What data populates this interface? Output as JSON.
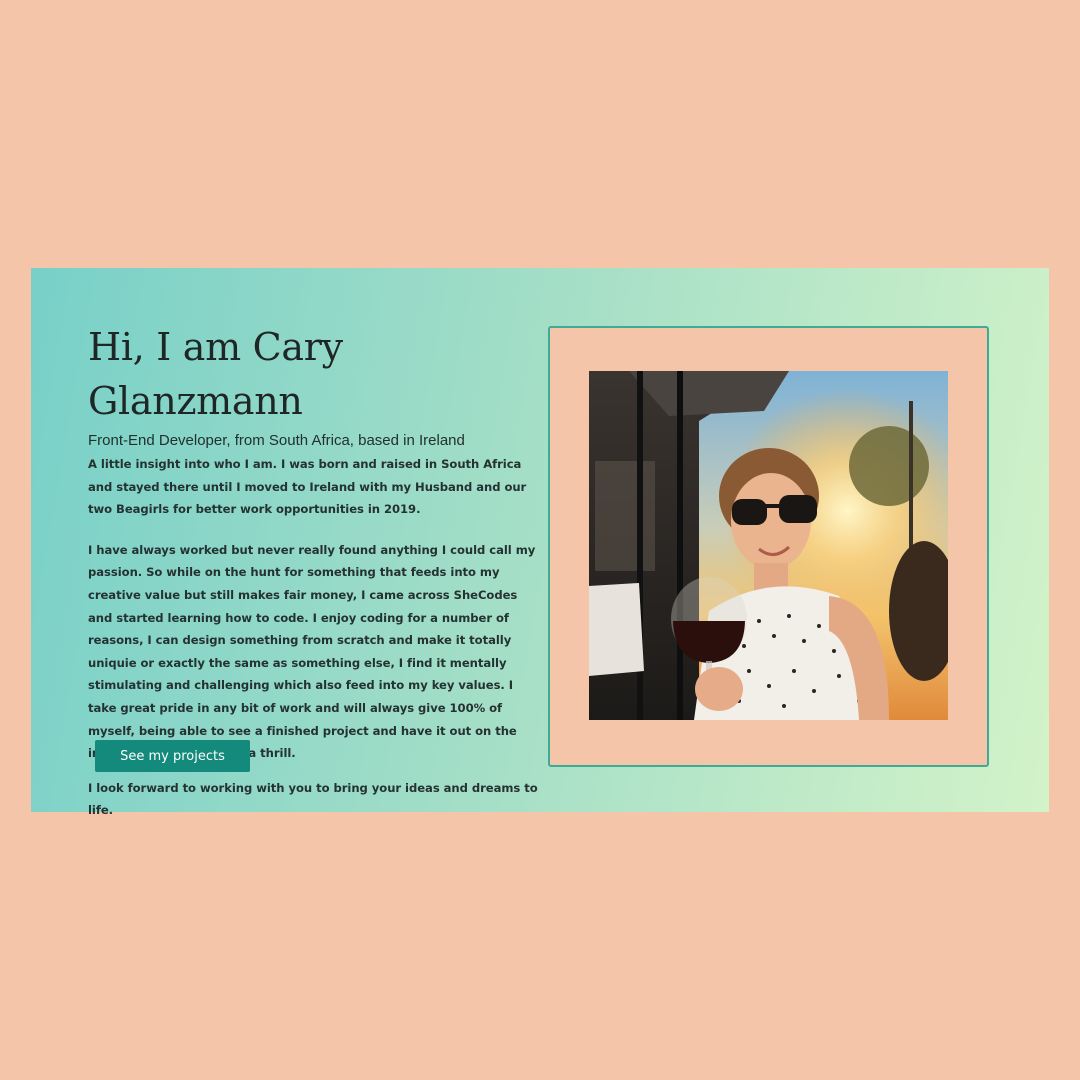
{
  "intro": {
    "title": "Hi, I am Cary Glanzmann",
    "subtitle": "Front-End Developer, from South Africa, based in Ireland",
    "paragraphs": [
      "A little insight into who I am. I was born and raised in South Africa and stayed there until I moved to Ireland with my Husband and our two Beagirls for better work opportunities in 2019.",
      "I have always worked but never really found anything I could call my passion. So while on the hunt for something that feeds into my creative value but still makes fair money, I came across SheCodes and started learning how to code. I enjoy coding for a number of reasons, I can design something from scratch and make it totally uniquie or exactly the same as something else, I find it mentally stimulating and challenging which also feed into my key values. I take great pride in any bit of work and will always give 100% of myself, being able to see a finished project and have it out on the internet forever is quite a thrill.",
      "I look forward to working with you to bring your ideas and dreams to life."
    ],
    "button_label": "See my projects"
  },
  "colors": {
    "page_background": "#f5c5a9",
    "gradient_start": "#78d0c8",
    "gradient_end": "#d3f3c9",
    "button": "#138a7c",
    "frame_border": "#3fab95"
  }
}
